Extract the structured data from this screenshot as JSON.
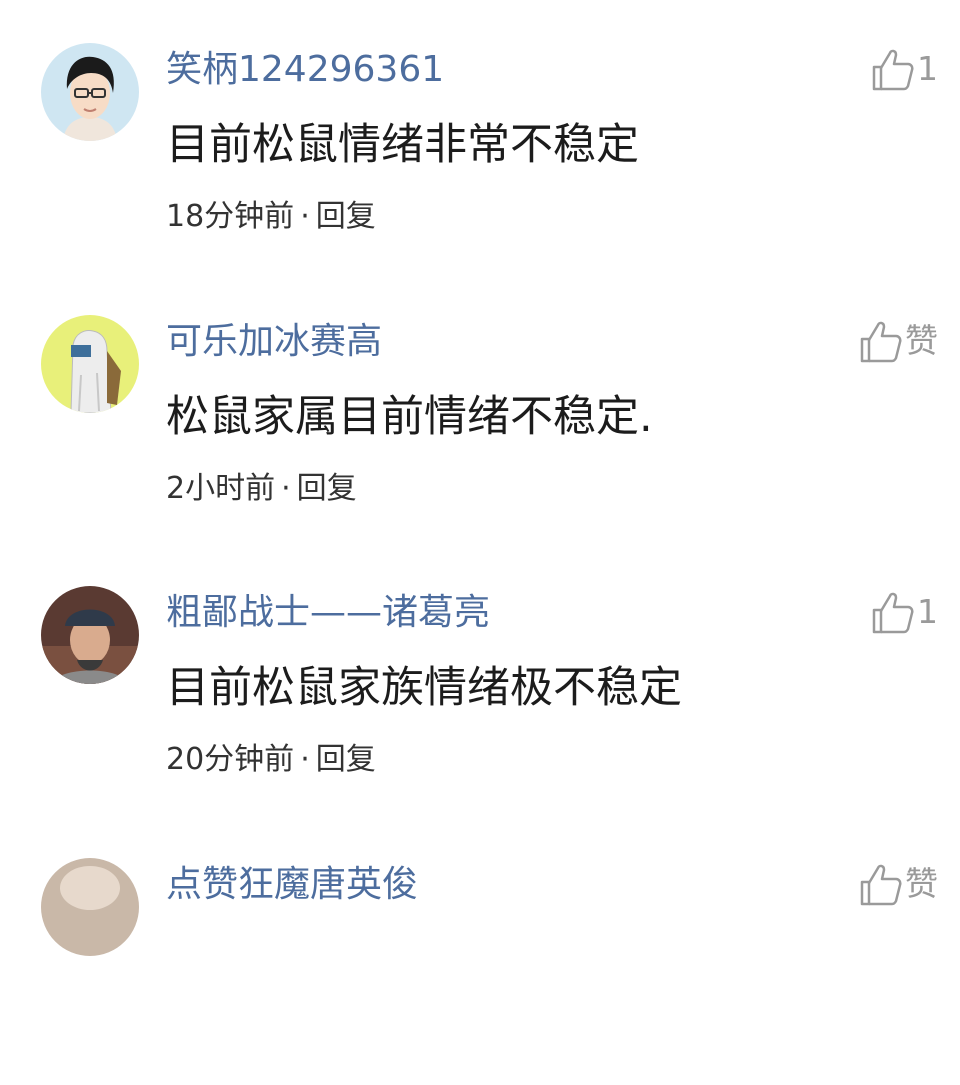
{
  "colors": {
    "username": "#4d6d9e",
    "body_text": "#1c1c1c",
    "meta_text": "#333333",
    "like_icon": "#9a9a9a"
  },
  "comments": [
    {
      "username": "笑柄124296361",
      "text": "目前松鼠情绪非常不稳定",
      "time": "18分钟前",
      "separator": "·",
      "reply": "回复",
      "like_icon": "thumbs-up-icon",
      "like_count": "1"
    },
    {
      "username": "可乐加冰赛高",
      "text": "松鼠家属目前情绪不稳定.",
      "time": "2小时前",
      "separator": "·",
      "reply": "回复",
      "like_icon": "thumbs-up-icon",
      "like_count": "赞"
    },
    {
      "username": "粗鄙战士——诸葛亮",
      "text": "目前松鼠家族情绪极不稳定",
      "time": "20分钟前",
      "separator": "·",
      "reply": "回复",
      "like_icon": "thumbs-up-icon",
      "like_count": "1"
    },
    {
      "username": "点赞狂魔唐英俊",
      "like_icon": "thumbs-up-icon",
      "like_count": "赞"
    }
  ]
}
